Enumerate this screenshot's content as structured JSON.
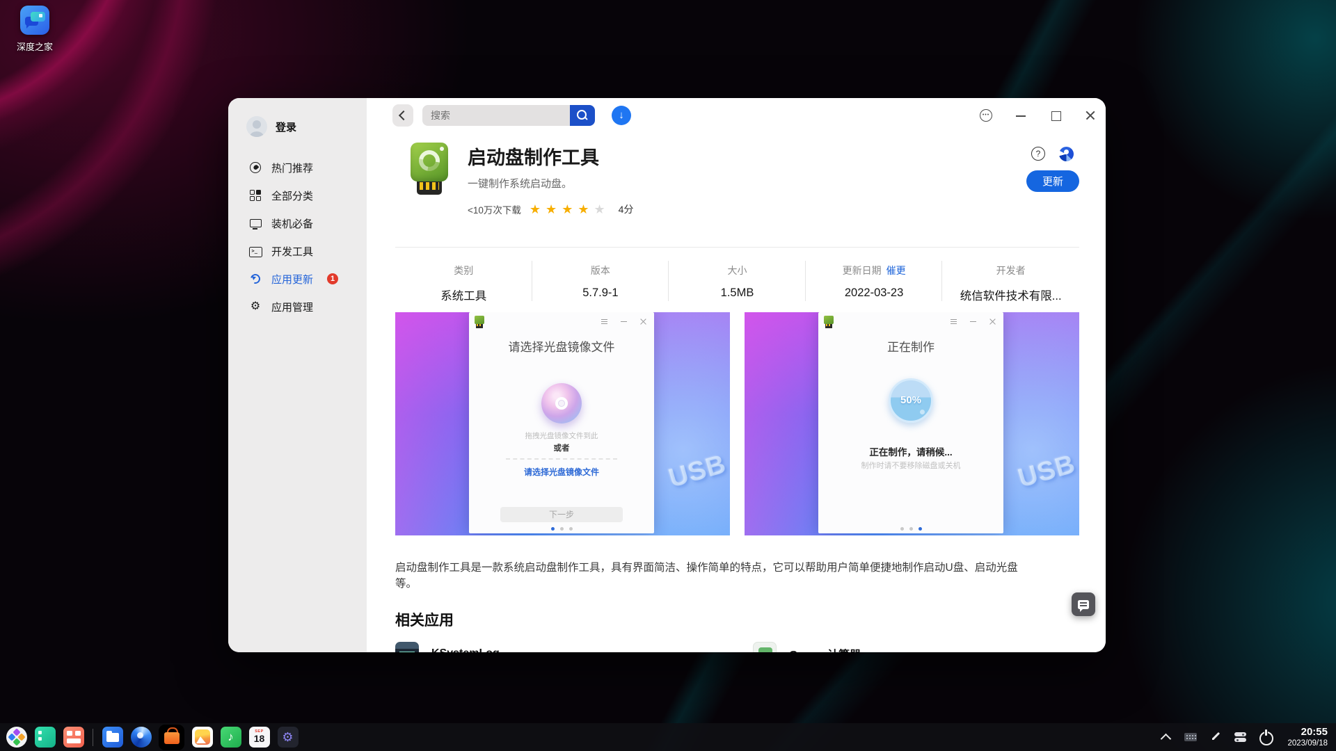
{
  "colors": {
    "accent": "#2464d9",
    "update_button": "#1566e0",
    "badge": "#e23a2b",
    "star_gold": "#f7ae00"
  },
  "desktop": {
    "shortcut_label": "深度之家",
    "taskbar": {
      "calendar_month": "SEP",
      "calendar_day": "18",
      "clock_time": "20:55",
      "clock_date": "2023/09/18"
    }
  },
  "window": {
    "titlebar": {
      "search_placeholder": "搜索",
      "download_arrow": "↓"
    },
    "sidebar": {
      "login_label": "登录",
      "items": [
        {
          "label": "热门推荐",
          "icon": "flame-icon",
          "active": false
        },
        {
          "label": "全部分类",
          "icon": "grid-icon",
          "active": false
        },
        {
          "label": "装机必备",
          "icon": "monitor-icon",
          "active": false
        },
        {
          "label": "开发工具",
          "icon": "terminal-icon",
          "active": false
        },
        {
          "label": "应用更新",
          "icon": "refresh-icon",
          "active": true,
          "badge": "1"
        },
        {
          "label": "应用管理",
          "icon": "gear-icon",
          "active": false
        }
      ]
    },
    "app": {
      "title": "启动盘制作工具",
      "subtitle": "一键制作系统启动盘。",
      "downloads": "<10万次下载",
      "stars_filled": 4,
      "stars_total": 5,
      "rating_label": "4分",
      "update_button": "更新"
    },
    "info": {
      "columns": [
        {
          "label": "类别",
          "value": "系统工具"
        },
        {
          "label": "版本",
          "value": "5.7.9-1"
        },
        {
          "label": "大小",
          "value": "1.5MB"
        },
        {
          "label": "更新日期",
          "link": "催更",
          "value": "2022-03-23"
        },
        {
          "label": "开发者",
          "value": "统信软件技术有限..."
        }
      ]
    },
    "screenshots": [
      {
        "window_title": "请选择光盘镜像文件",
        "drop_hint": "拖拽光盘镜像文件到此",
        "or_label": "或者",
        "choose_link": "请选择光盘镜像文件",
        "next_button": "下一步",
        "usb_text": "USB",
        "active_dot": 0
      },
      {
        "window_title": "正在制作",
        "progress": "50%",
        "status": "正在制作，请稍候...",
        "warning": "制作时请不要移除磁盘或关机",
        "usb_text": "USB",
        "active_dot": 2
      }
    ],
    "description": "启动盘制作工具是一款系统启动盘制作工具，具有界面简洁、操作简单的特点，它可以帮助用户简单便捷地制作启动U盘、启动光盘等。",
    "related": {
      "heading": "相关应用",
      "apps": [
        {
          "name": "KSystemLog"
        },
        {
          "name": "Gnome计算器"
        }
      ]
    }
  }
}
